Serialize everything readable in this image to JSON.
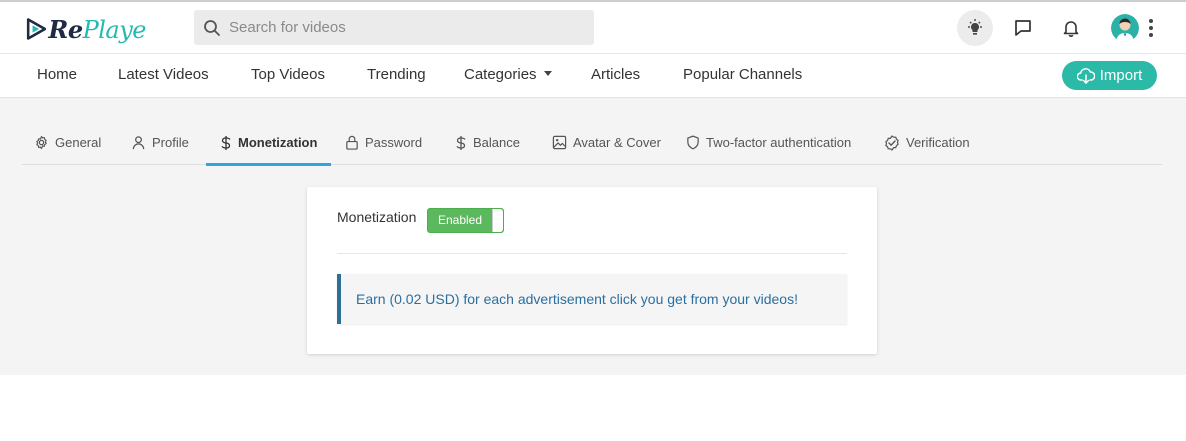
{
  "app": {
    "logo_text_1": "Re",
    "logo_text_2": "Playe"
  },
  "header": {
    "search_placeholder": "Search for videos",
    "icons": [
      "lightbulb-icon",
      "chat-icon",
      "bell-icon",
      "avatar",
      "kebab-menu-icon"
    ]
  },
  "nav": {
    "items": [
      {
        "label": "Home"
      },
      {
        "label": "Latest Videos"
      },
      {
        "label": "Top Videos"
      },
      {
        "label": "Trending"
      },
      {
        "label": "Categories"
      },
      {
        "label": "Articles"
      },
      {
        "label": "Popular Channels"
      }
    ],
    "import_label": "Import"
  },
  "settings_tabs": [
    {
      "label": "General",
      "icon": "gear-icon"
    },
    {
      "label": "Profile",
      "icon": "user-icon"
    },
    {
      "label": "Monetization",
      "icon": "dollar-icon",
      "active": true
    },
    {
      "label": "Password",
      "icon": "lock-icon"
    },
    {
      "label": "Balance",
      "icon": "dollar-icon"
    },
    {
      "label": "Avatar & Cover",
      "icon": "image-icon"
    },
    {
      "label": "Two-factor authentication",
      "icon": "shield-icon"
    },
    {
      "label": "Verification",
      "icon": "verified-badge-icon"
    }
  ],
  "monetization": {
    "label": "Monetization",
    "toggle_label": "Enabled",
    "toggle_on": true,
    "info_text": "Earn (0.02 USD) for each advertisement click you get from your videos!"
  },
  "colors": {
    "accent_teal": "#2bb9a8",
    "active_tab": "#2aa8dd",
    "toggle_green": "#5cb85c",
    "info_text": "#2a6fa0",
    "info_border": "#2e6f96"
  }
}
